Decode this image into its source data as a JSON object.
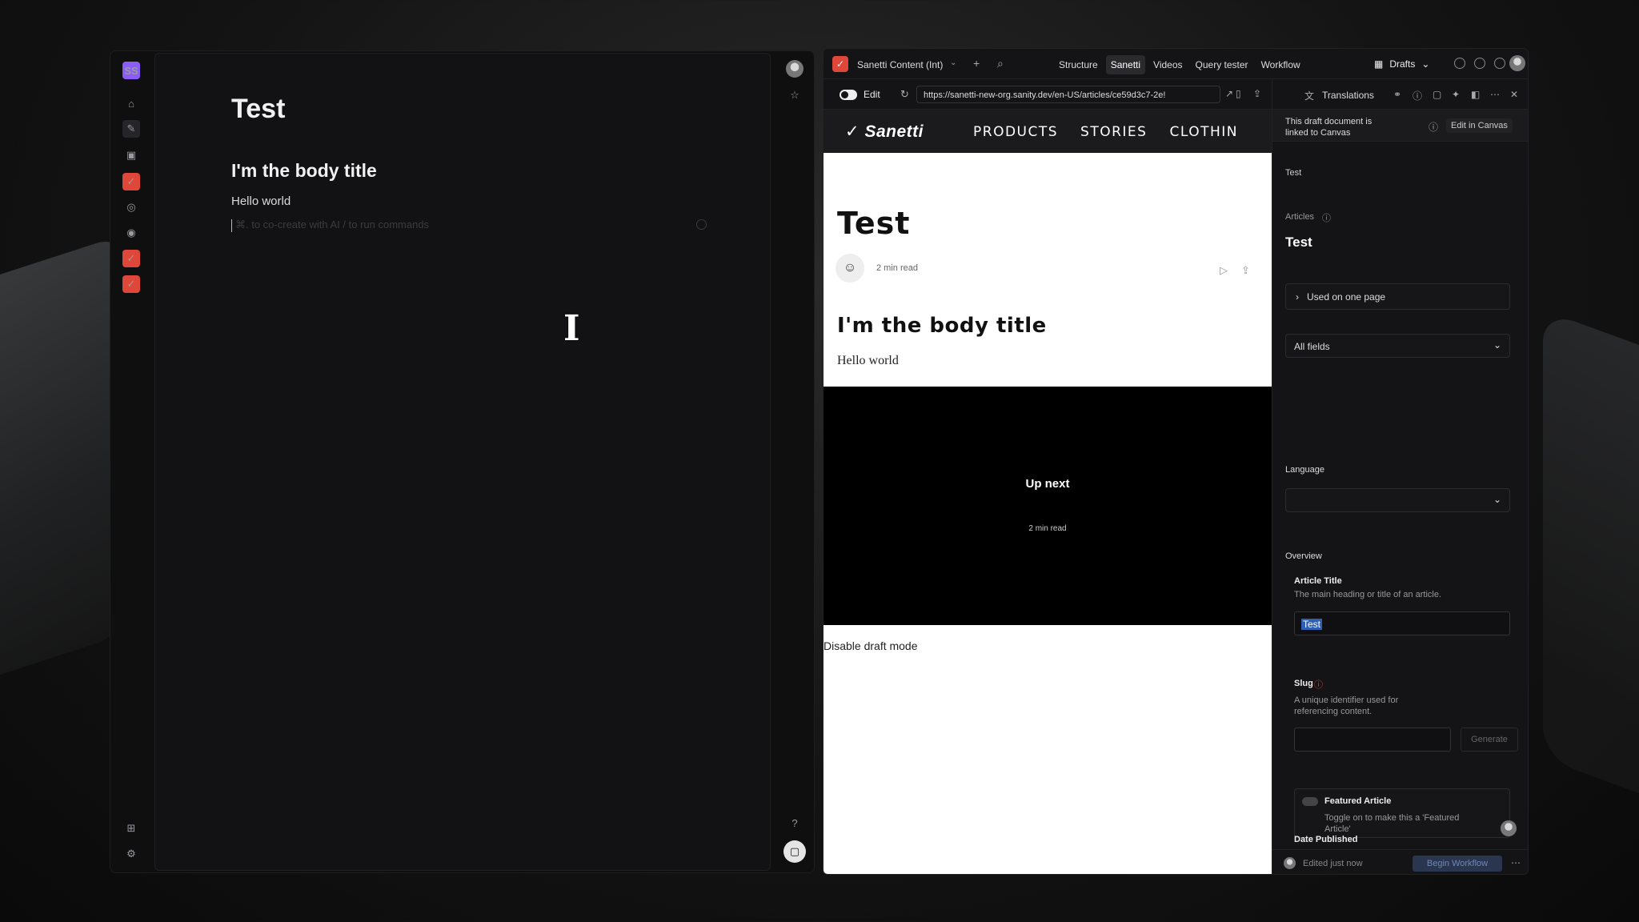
{
  "canvas": {
    "workspace_badge": "SS",
    "doc_title": "Test",
    "body_heading": "I'm the body title",
    "body_text": "Hello world",
    "hint_text": "⌘. to co-create with AI / to run commands"
  },
  "studio": {
    "workspace_name": "Sanetti Content (Int)",
    "tabs": [
      "Structure",
      "Sanetti",
      "Videos",
      "Query tester",
      "Workflow"
    ],
    "active_tab": "Sanetti",
    "perspective": "Drafts",
    "edit_label": "Edit",
    "url": "https://sanetti-new-org.sanity.dev/en-US/articles/ce59d3c7-2e!"
  },
  "preview": {
    "logo": "Sanetti",
    "nav_links": [
      "PRODUCTS",
      "STORIES",
      "CLOTHIN"
    ],
    "title": "Test",
    "read_time": "2 min read",
    "body_heading": "I'm the body title",
    "body_text": "Hello world",
    "up_next": "Up next",
    "up_next_read": "2 min read",
    "disable_draft": "Disable draft mode"
  },
  "panel": {
    "header_title": "Translations",
    "linked_text": "This draft document is linked to Canvas",
    "edit_in_canvas": "Edit in Canvas",
    "doc_small_title": "Test",
    "type_label": "Articles",
    "doc_title": "Test",
    "used_on": "Used on one page",
    "fields_select": "All fields",
    "language_label": "Language",
    "overview_label": "Overview",
    "article_title_label": "Article Title",
    "article_title_desc": "The main heading or title of an article.",
    "article_title_value": "Test",
    "slug_label": "Slug",
    "slug_desc": "A unique identifier used for referencing content.",
    "generate_label": "Generate",
    "featured_label": "Featured Article",
    "featured_desc": "Toggle on to make this a 'Featured Article'",
    "date_label": "Date Published",
    "edited": "Edited just now",
    "begin_workflow": "Begin Workflow"
  }
}
